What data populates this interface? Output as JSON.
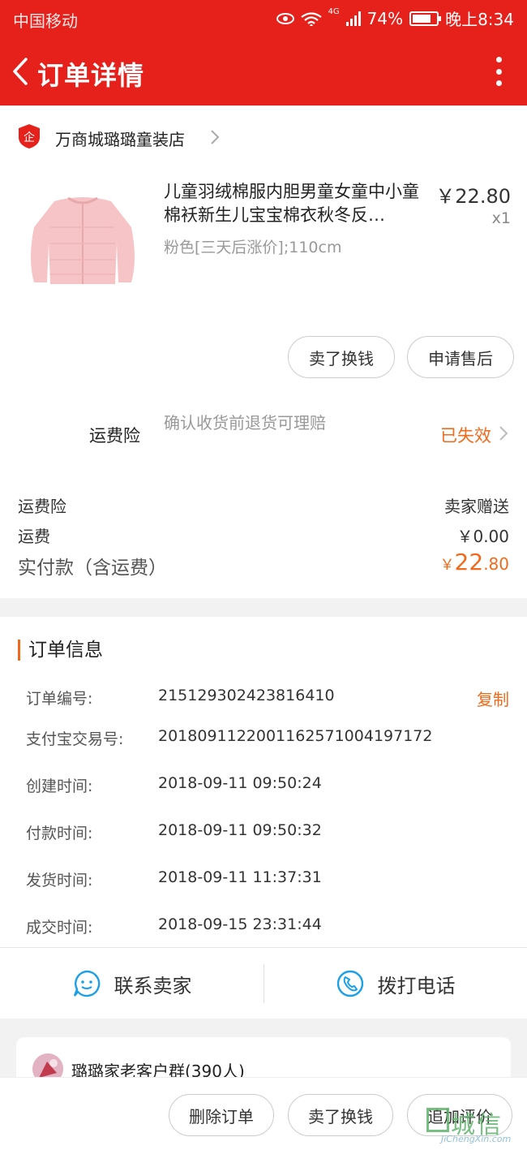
{
  "status_bar": {
    "carrier": "中国移动",
    "network": "4G",
    "battery": "74%",
    "time": "晚上8:34"
  },
  "nav": {
    "title": "订单详情"
  },
  "shop": {
    "name": "万商城璐璐童装店"
  },
  "product": {
    "title": "儿童羽绒棉服内胆男童女童中小童棉袄新生儿宝宝棉衣秋冬反…",
    "price": "￥22.80",
    "qty": "x1",
    "sku": "粉色[三天后涨价];110cm"
  },
  "item_actions": {
    "sell_exchange": "卖了换钱",
    "after_sale": "申请售后"
  },
  "insurance": {
    "label": "运费险",
    "description": "确认收货前退货可理赔",
    "status": "已失效"
  },
  "fees": [
    {
      "label": "运费险",
      "value": "卖家赠送"
    },
    {
      "label": "运费",
      "value": "￥0.00"
    }
  ],
  "paid": {
    "label": "实付款（含运费）",
    "currency": "￥",
    "integer": "22",
    "decimal": ".80"
  },
  "order_info": {
    "title": "订单信息",
    "copy_label": "复制",
    "rows": [
      {
        "label": "订单编号:",
        "value": "215129302423816410"
      },
      {
        "label": "支付宝交易号:",
        "value": "2018091122001162571004197172"
      },
      {
        "label": "创建时间:",
        "value": "2018-09-11 09:50:24"
      },
      {
        "label": "付款时间:",
        "value": "2018-09-11 09:50:32"
      },
      {
        "label": "发货时间:",
        "value": "2018-09-11 11:37:31"
      },
      {
        "label": "成交时间:",
        "value": "2018-09-15 23:31:44"
      }
    ]
  },
  "contact": {
    "seller": "联系卖家",
    "phone": "拨打电话"
  },
  "group": {
    "name": "璐璐家老客户群(390人)"
  },
  "bottom_actions": {
    "delete": "删除订单",
    "sell_exchange": "卖了换钱",
    "review": "追加评价"
  },
  "watermark": {
    "text": "城信",
    "url": "JiChengXin.com"
  },
  "colors": {
    "brand_red": "#e6211b",
    "accent_orange": "#f06a1c",
    "icon_blue": "#1aa0e6"
  }
}
